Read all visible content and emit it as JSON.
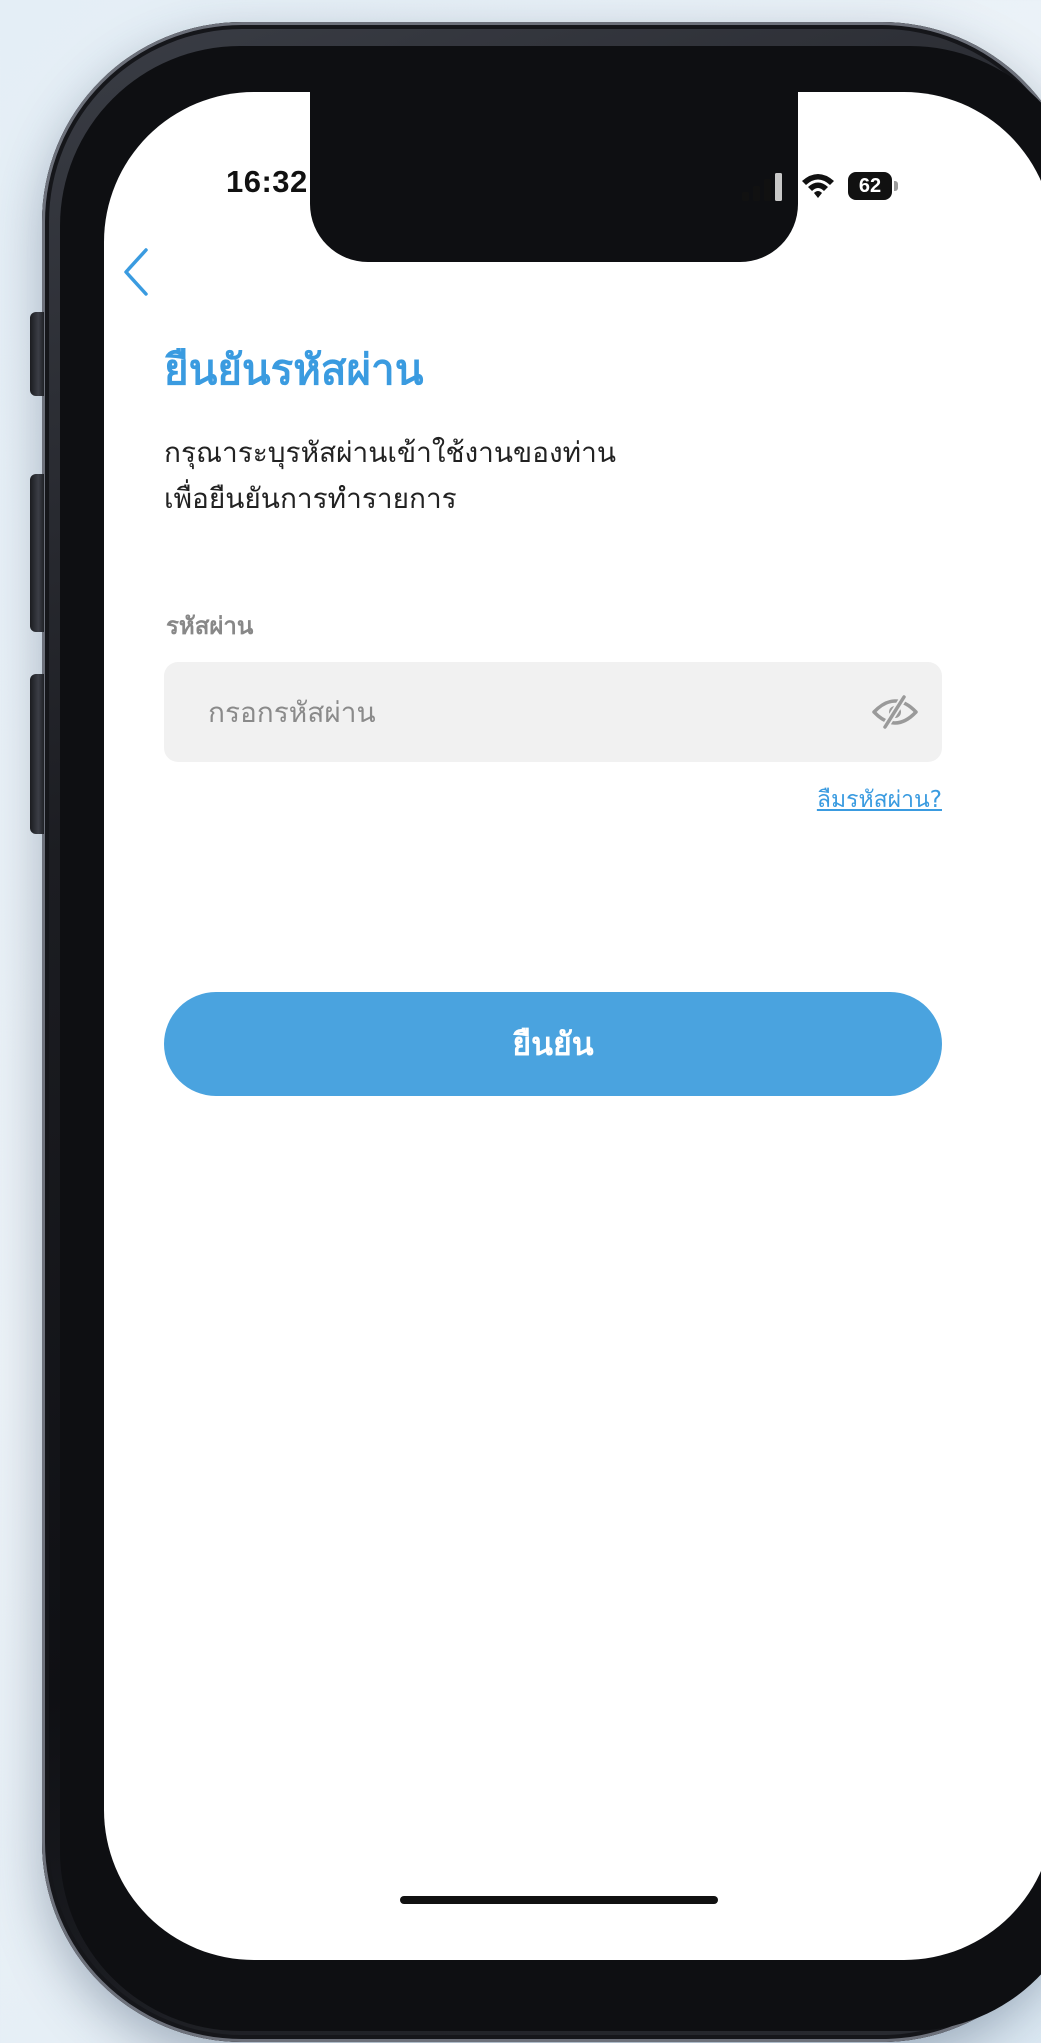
{
  "status_bar": {
    "time": "16:32",
    "battery_level": "62",
    "signal_icon": "cellular-signal-icon",
    "wifi_icon": "wifi-icon",
    "battery_icon": "battery-icon"
  },
  "nav": {
    "back_icon": "chevron-left-icon"
  },
  "header": {
    "title": "ยืนยันรหัสผ่าน",
    "subtitle_lines": [
      "กรุณาระบุรหัสผ่านเข้าใช้งานของท่าน",
      "เพื่อยืนยันการทำรายการ"
    ]
  },
  "form": {
    "password_label": "รหัสผ่าน",
    "password_value": "",
    "password_placeholder": "กรอกรหัสผ่าน",
    "visibility_icon": "eye-off-icon",
    "forgot_password": "ลืมรหัสผ่าน?"
  },
  "actions": {
    "confirm_label": "ยืนยัน"
  },
  "colors": {
    "accent": "#3a9be0",
    "button": "#4aa3df",
    "field_background": "#f1f1f1",
    "label_gray": "#888888"
  }
}
